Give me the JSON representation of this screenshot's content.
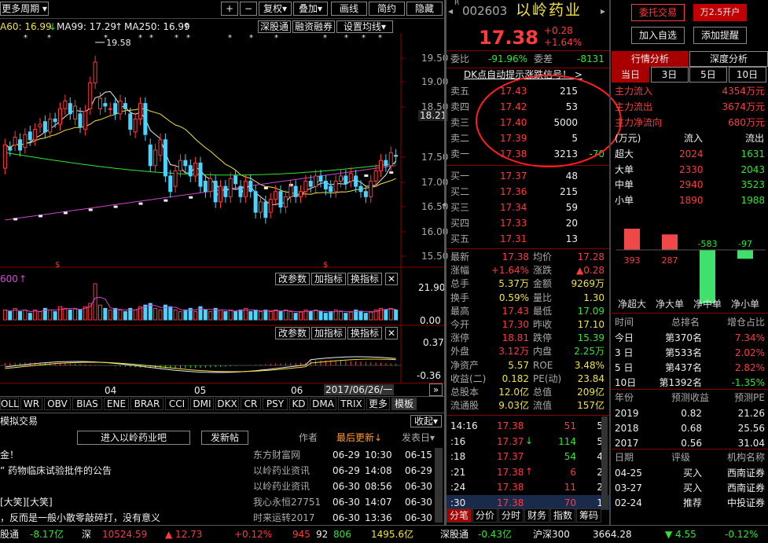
{
  "toolbar": {
    "period": "更多周期",
    "plus": "+",
    "minus": "−",
    "fuquan": "复权",
    "diejia": "叠加",
    "huaxian": "画线",
    "jianyue": "简约",
    "yincang": "隐藏"
  },
  "ma": {
    "ma60": "A60: 16.99",
    "ma99": "MA99: 17.29",
    "ma250": "MA250: 16.99",
    "btn_sgt": "深股通",
    "btn_rzrq": "融资融券",
    "btn_setma": "设置均线"
  },
  "price_axis": [
    "19.50",
    "19.00",
    "18.50",
    "18.21",
    "17.50",
    "17.00",
    "16.50",
    "16.00",
    "15.50"
  ],
  "vol_axis": [
    "21.90",
    "0.00"
  ],
  "macd_axis": [
    "0.37",
    "-0.36"
  ],
  "peak_label": "19.58",
  "vol_header": {
    "label": "600",
    "btns": [
      "改参数",
      "加指标",
      "换指标"
    ]
  },
  "macd_header": {
    "btns": [
      "改参数",
      "加指标",
      "换指标"
    ]
  },
  "x_axis": [
    "04",
    "05",
    "06"
  ],
  "date_label": "2017/06/26/一",
  "indicator_tabs": [
    "OLL",
    "WR",
    "OBV",
    "BIAS",
    "ENE",
    "BRAR",
    "CCI",
    "DMI",
    "DKX",
    "CR",
    "PSY",
    "KD",
    "DMA",
    "TRIX",
    "更多",
    "模板"
  ],
  "chart_data": {
    "type": "candlestick",
    "title": "002603 以岭药业",
    "ma_labels": [
      "MA60",
      "MA99",
      "MA250"
    ],
    "ylim": [
      15.3,
      19.7
    ],
    "candles": [
      [
        17.15,
        17.6
      ],
      [
        17.55,
        17.5
      ],
      [
        17.6,
        17.75
      ],
      [
        17.7,
        17.5
      ],
      [
        17.55,
        17.8
      ],
      [
        17.85,
        17.7
      ],
      [
        17.7,
        17.9
      ],
      [
        17.95,
        18.0
      ],
      [
        18.05,
        17.85
      ],
      [
        17.85,
        18.1
      ],
      [
        18.1,
        18.05
      ],
      [
        18.0,
        18.3
      ],
      [
        18.3,
        18.45
      ],
      [
        18.4,
        18.2
      ],
      [
        18.1,
        18.35
      ],
      [
        18.2,
        17.95
      ],
      [
        17.9,
        18.25
      ],
      [
        18.3,
        18.8
      ],
      [
        18.8,
        19.2
      ],
      [
        18.3,
        18.5
      ],
      [
        18.4,
        18.35
      ],
      [
        18.3,
        18.3
      ],
      [
        18.4,
        18.2
      ],
      [
        18.2,
        18.45
      ],
      [
        18.4,
        18.3
      ],
      [
        18.2,
        17.9
      ],
      [
        17.85,
        18.1
      ],
      [
        18.1,
        18.4
      ],
      [
        18.4,
        17.8
      ],
      [
        17.6,
        17.2
      ],
      [
        17.2,
        17.5
      ],
      [
        17.4,
        17.7
      ],
      [
        17.7,
        17.0
      ],
      [
        17.0,
        16.7
      ],
      [
        16.8,
        17.1
      ],
      [
        17.1,
        17.3
      ],
      [
        17.3,
        17.2
      ],
      [
        17.2,
        17.0
      ],
      [
        17.0,
        17.25
      ],
      [
        17.25,
        16.8
      ],
      [
        16.9,
        16.7
      ],
      [
        16.7,
        16.95
      ],
      [
        16.9,
        16.5
      ],
      [
        16.5,
        16.8
      ],
      [
        16.8,
        16.6
      ],
      [
        16.6,
        16.95
      ],
      [
        17.0,
        16.85
      ],
      [
        16.8,
        16.6
      ],
      [
        16.6,
        16.9
      ],
      [
        16.9,
        16.7
      ],
      [
        16.7,
        16.3
      ],
      [
        16.3,
        16.5
      ],
      [
        16.5,
        16.2
      ],
      [
        16.3,
        16.55
      ],
      [
        16.55,
        16.7
      ],
      [
        16.7,
        16.4
      ],
      [
        16.4,
        16.6
      ],
      [
        16.6,
        16.8
      ],
      [
        16.8,
        16.6
      ],
      [
        16.6,
        16.7
      ],
      [
        16.7,
        16.9
      ],
      [
        16.9,
        16.8
      ],
      [
        16.8,
        17.0
      ],
      [
        17.0,
        16.9
      ],
      [
        16.9,
        16.75
      ],
      [
        16.8,
        16.7
      ],
      [
        16.7,
        16.9
      ],
      [
        16.9,
        17.0
      ],
      [
        17.0,
        16.85
      ],
      [
        16.9,
        17.05
      ],
      [
        17.0,
        16.8
      ],
      [
        16.8,
        16.7
      ],
      [
        16.7,
        16.6
      ],
      [
        16.6,
        16.9
      ],
      [
        16.9,
        17.1
      ],
      [
        17.1,
        17.3
      ],
      [
        17.3,
        17.2
      ],
      [
        17.2,
        17.45
      ],
      [
        17.4,
        17.38
      ]
    ],
    "volume": [
      6,
      5,
      7,
      5,
      6,
      4,
      6,
      5,
      7,
      6,
      5,
      8,
      7,
      6,
      7,
      6,
      8,
      10,
      22,
      9,
      7,
      6,
      7,
      6,
      5,
      7,
      6,
      8,
      9,
      10,
      7,
      6,
      9,
      8,
      6,
      5,
      6,
      7,
      5,
      8,
      6,
      5,
      7,
      6,
      5,
      6,
      5,
      6,
      7,
      5,
      6,
      5,
      6,
      5,
      6,
      5,
      6,
      5,
      4,
      5,
      6,
      5,
      6,
      5,
      4,
      5,
      6,
      5,
      4,
      5,
      6,
      5,
      4,
      5,
      6,
      7,
      6,
      7,
      6
    ]
  },
  "stock": {
    "code": "002603",
    "name": "以岭药业",
    "price": "17.38",
    "change": "+0.28",
    "pct": "+1.64%",
    "btn_wtjy": "委托交易",
    "btn_kaihu": "万2.5开户",
    "btn_zixuan": "加入自选",
    "btn_tixing": "添加提醒"
  },
  "weibi": {
    "label1": "委比",
    "val1": "-91.96%",
    "label2": "委差",
    "val2": "-8131"
  },
  "dk_signal": "DK点自动提示涨跌信号！ >",
  "asks": [
    {
      "l": "卖五",
      "p": "17.43",
      "v": "215"
    },
    {
      "l": "卖四",
      "p": "17.42",
      "v": "53"
    },
    {
      "l": "卖三",
      "p": "17.40",
      "v": "5000"
    },
    {
      "l": "卖二",
      "p": "17.39",
      "v": "5"
    },
    {
      "l": "卖一",
      "p": "17.38",
      "v": "3213",
      "d": "-70"
    }
  ],
  "bids": [
    {
      "l": "买一",
      "p": "17.37",
      "v": "48"
    },
    {
      "l": "买二",
      "p": "17.36",
      "v": "215"
    },
    {
      "l": "买三",
      "p": "17.34",
      "v": "59"
    },
    {
      "l": "买四",
      "p": "17.33",
      "v": "20"
    },
    {
      "l": "买五",
      "p": "17.31",
      "v": "13"
    }
  ],
  "quote": [
    {
      "l1": "最新",
      "v1": "17.38",
      "c1": "red",
      "l2": "均价",
      "v2": "17.28",
      "c2": "red"
    },
    {
      "l1": "涨幅",
      "v1": "+1.64%",
      "c1": "red",
      "l2": "涨跌",
      "v2": "▲0.28",
      "c2": "red"
    },
    {
      "l1": "总手",
      "v1": "5.37万",
      "c1": "yel",
      "l2": "金额",
      "v2": "9269万",
      "c2": "yel"
    },
    {
      "l1": "换手",
      "v1": "0.59%",
      "c1": "yel",
      "l2": "量比",
      "v2": "1.30",
      "c2": "yel"
    },
    {
      "l1": "最高",
      "v1": "17.43",
      "c1": "red",
      "l2": "最低",
      "v2": "17.09",
      "c2": "grn"
    },
    {
      "l1": "今开",
      "v1": "17.30",
      "c1": "red",
      "l2": "昨收",
      "v2": "17.10",
      "c2": "yel"
    },
    {
      "l1": "涨停",
      "v1": "18.81",
      "c1": "red",
      "l2": "跌停",
      "v2": "15.39",
      "c2": "grn"
    },
    {
      "l1": "外盘",
      "v1": "3.12万",
      "c1": "red",
      "l2": "内盘",
      "v2": "2.25万",
      "c2": "grn"
    },
    {
      "l1": "净资产",
      "v1": "5.57",
      "c1": "yel",
      "l2": "ROE",
      "v2": "3.48%",
      "c2": "yel"
    },
    {
      "l1": "收益(二)",
      "v1": "0.182",
      "c1": "yel",
      "l2": "PE(动)",
      "v2": "23.84",
      "c2": "yel"
    },
    {
      "l1": "总股本",
      "v1": "12.0亿",
      "c1": "yel",
      "l2": "总值",
      "v2": "209亿",
      "c2": "yel"
    },
    {
      "l1": "流通股",
      "v1": "9.03亿",
      "c1": "yel",
      "l2": "流值",
      "v2": "157亿",
      "c2": "yel"
    }
  ],
  "ticks": [
    {
      "t": "14:16",
      "p": "17.38",
      "pc": "red",
      "a": "",
      "v": "51",
      "vc": "red",
      "n": "5"
    },
    {
      "t": ":16",
      "p": "17.37",
      "pc": "red",
      "a": "↓",
      "v": "114",
      "vc": "grn",
      "n": "5"
    },
    {
      "t": ":18",
      "p": "17.37",
      "pc": "red",
      "a": "",
      "v": "54",
      "vc": "grn",
      "n": "4"
    },
    {
      "t": ":21",
      "p": "17.38",
      "pc": "red",
      "a": "↑",
      "v": "6",
      "vc": "red",
      "n": "2"
    },
    {
      "t": ":24",
      "p": "17.38",
      "pc": "red",
      "a": "",
      "v": "11",
      "vc": "red",
      "n": "2"
    },
    {
      "t": ":30",
      "p": "17.38",
      "pc": "red",
      "a": "",
      "v": "70",
      "vc": "red",
      "n": "1"
    }
  ],
  "tick_tabs": [
    "分笔",
    "分价",
    "分时",
    "财务",
    "指数",
    "筹码"
  ],
  "flow": {
    "tab1": "行情分析",
    "tab2": "深度分析",
    "periods": [
      "当日",
      "3日",
      "5日",
      "10日"
    ],
    "inflow_l": "主力流入",
    "inflow_v": "4354万元",
    "outflow_l": "主力流出",
    "outflow_v": "3674万元",
    "net_l": "主力净流向",
    "net_v": "680万元",
    "unit": "(万元)",
    "col_in": "流入",
    "col_out": "流出",
    "rows": [
      {
        "l": "超大",
        "i": "2024",
        "o": "1631"
      },
      {
        "l": "大单",
        "i": "2330",
        "o": "2043"
      },
      {
        "l": "中单",
        "i": "2940",
        "o": "3523"
      },
      {
        "l": "小单",
        "i": "1890",
        "o": "1988"
      }
    ],
    "bars": [
      {
        "label": "净超大",
        "v": 393
      },
      {
        "label": "净大单",
        "v": 287
      },
      {
        "label": "净中单",
        "v": -583
      },
      {
        "label": "净小单",
        "v": -97
      }
    ],
    "bar_vals": [
      "393",
      "287",
      "-583",
      "-97"
    ]
  },
  "rank": {
    "headers": [
      "时间",
      "总排名",
      "增仓占比"
    ],
    "rows": [
      {
        "a": "今日",
        "b": "第370名",
        "c": "7.34%"
      },
      {
        "a": "3 日",
        "b": "第533名",
        "c": "2.02%"
      },
      {
        "a": "5 日",
        "b": "第437名",
        "c": "2.82%"
      },
      {
        "a": "10日",
        "b": "第1392名",
        "c": "-1.35%"
      }
    ]
  },
  "forecast": {
    "headers": [
      "年份",
      "预测收益",
      "预测PE"
    ],
    "rows": [
      {
        "a": "2019",
        "b": "0.82",
        "c": "21.26"
      },
      {
        "a": "2018",
        "b": "0.68",
        "c": "25.56"
      },
      {
        "a": "2017",
        "b": "0.56",
        "c": "31.04"
      }
    ]
  },
  "rating": {
    "headers": [
      "日期",
      "评级",
      "机构名称"
    ],
    "rows": [
      {
        "a": "04-25",
        "b": "买入",
        "c": "西南证券"
      },
      {
        "a": "03-27",
        "b": "买入",
        "c": "西南证券"
      },
      {
        "a": "02-24",
        "b": "推荐",
        "c": "中投证券"
      }
    ]
  },
  "forum": {
    "tab": "模拟交易",
    "collapse": "收起",
    "enter": "进入以岭药业吧",
    "post": "发新帖",
    "col_author": "作者",
    "col_latest": "最后更新↓",
    "col_posted": "发表日",
    "rows": [
      {
        "title": "金！",
        "author": "东方财富网",
        "d": "06-29",
        "tm": "10:30",
        "p": "06-15"
      },
      {
        "title": "” 药物临床试验批件的公告",
        "author": "以岭药业资讯",
        "d": "06-29",
        "tm": "14:08",
        "p": "06-29"
      },
      {
        "title": "",
        "author": "以岭药业资讯",
        "d": "06-30",
        "tm": "08:56",
        "p": "06-30"
      },
      {
        "title": "[大笑][大笑]",
        "author": "我心永恒27751",
        "d": "06-30",
        "tm": "14:07",
        "p": "06-30"
      },
      {
        "title": "，反而是一般小散零敲碎打，没有意义",
        "author": "时来运转2017",
        "d": "06-30",
        "tm": "13:36",
        "p": "06-30"
      }
    ]
  },
  "status": {
    "a": "股通",
    "b": "-8.17亿",
    "c": "深",
    "d": "10524.59",
    "e": "▲ 12.73",
    "f": "+0.12%",
    "g": "945",
    "h": "92",
    "i": "806",
    "j": "1495.6亿",
    "k": "深股通",
    "l": "-0.43亿",
    "m": "沪深300",
    "n": "3664.28",
    "o": "▼ 4.55",
    "p": "-0.12%"
  }
}
